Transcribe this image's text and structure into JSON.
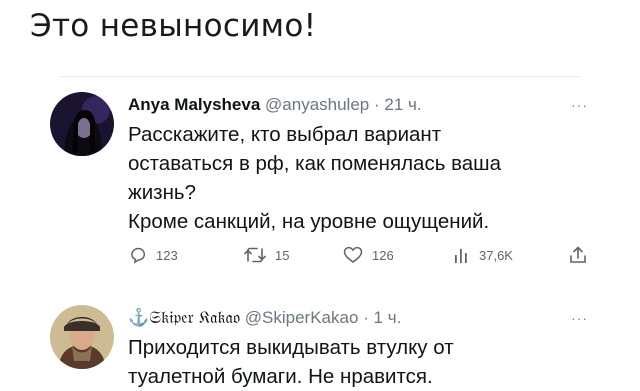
{
  "headline": "Это невыносимо!",
  "tweet1": {
    "name": "Anya Malysheva",
    "handle": "@anyashulep",
    "time": "21 ч.",
    "text": "Расскажите, кто выбрал вариант\nоставаться в рф, как поменялась ваша\nжизнь?\nКроме санкций, на уровне ощущений.",
    "more_icon": "more-icon",
    "stats": {
      "replies": "123",
      "retweets": "15",
      "likes": "126",
      "views": "37,6K"
    }
  },
  "tweet2": {
    "name": "⚓𝔖𝔨𝔦𝔭𝔢𝔯 𝔎𝔞𝔨𝔞𝔬",
    "handle": "@SkiperKakao",
    "time": "1 ч.",
    "text": "Приходится выкидывать втулку от\nтуалетной бумаги. Не нравится."
  },
  "colors": {
    "text": "#0f1419",
    "muted": "#6b7680",
    "divider": "#e6e8ea"
  }
}
